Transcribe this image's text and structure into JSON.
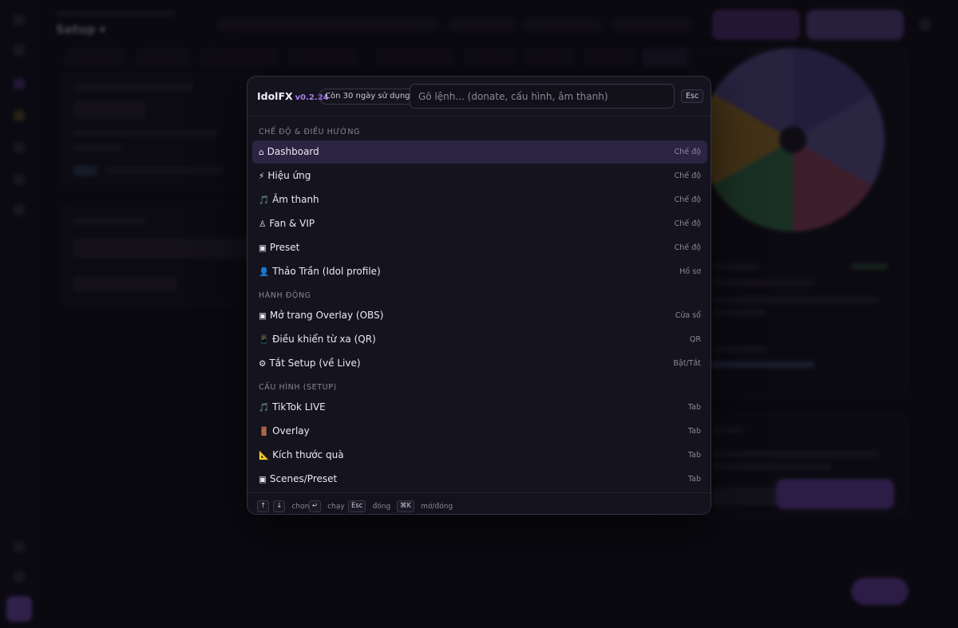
{
  "palette": {
    "brand": "IdolFX",
    "version": "v0.2.24",
    "trial_badge": "Còn 30 ngày sử dụng",
    "search_placeholder": "Gõ lệnh... (donate, cấu hình, âm thanh)",
    "close_key": "Esc",
    "sections": [
      {
        "title": "CHẾ ĐỘ & ĐIỀU HƯỚNG",
        "items": [
          {
            "icon": "home-icon",
            "glyph": "⌂",
            "label": "Dashboard",
            "tag": "Chế độ",
            "active": true
          },
          {
            "icon": "lightning-icon",
            "glyph": "⚡",
            "label": "Hiệu ứng",
            "tag": "Chế độ"
          },
          {
            "icon": "music-note-icon",
            "glyph": "🎵",
            "label": "Âm thanh",
            "tag": "Chế độ"
          },
          {
            "icon": "fan-icon",
            "glyph": "♙",
            "label": "Fan & VIP",
            "tag": "Chế độ"
          },
          {
            "icon": "preset-icon",
            "glyph": "▣",
            "label": "Preset",
            "tag": "Chế độ"
          },
          {
            "icon": "profile-icon",
            "glyph": "👤",
            "label": "Thảo Trần (Idol profile)",
            "tag": "Hồ sơ"
          }
        ]
      },
      {
        "title": "HÀNH ĐỘNG",
        "items": [
          {
            "icon": "window-icon",
            "glyph": "▣",
            "label": "Mở trang Overlay (OBS)",
            "tag": "Cửa sổ"
          },
          {
            "icon": "phone-icon",
            "glyph": "📱",
            "label": "Điều khiển từ xa (QR)",
            "tag": "QR"
          },
          {
            "icon": "gear-icon",
            "glyph": "⚙",
            "label": "Tắt Setup (về Live)",
            "tag": "Bật/Tắt"
          }
        ]
      },
      {
        "title": "CẤU HÌNH (SETUP)",
        "items": [
          {
            "icon": "music-note-icon",
            "glyph": "🎵",
            "label": "TikTok LIVE",
            "tag": "Tab"
          },
          {
            "icon": "door-icon",
            "glyph": "🚪",
            "label": "Overlay",
            "tag": "Tab"
          },
          {
            "icon": "ruler-icon",
            "glyph": "📐",
            "label": "Kích thước quà",
            "tag": "Tab"
          },
          {
            "icon": "scenes-icon",
            "glyph": "▣",
            "label": "Scenes/Preset",
            "tag": "Tab"
          }
        ]
      }
    ],
    "footer": {
      "navigate_keys": [
        "↑",
        "↓"
      ],
      "navigate_label": "chọn",
      "run_key": "↵",
      "run_label": "chạy",
      "close_key": "Esc",
      "close_label": "đóng",
      "toggle_key": "⌘K",
      "toggle_label": "mở/đóng"
    }
  },
  "background": {
    "title": "Setup ▾"
  },
  "colors": {
    "accent": "#a77ef0",
    "active_row": "#2c2442",
    "panel": "#15131d"
  }
}
